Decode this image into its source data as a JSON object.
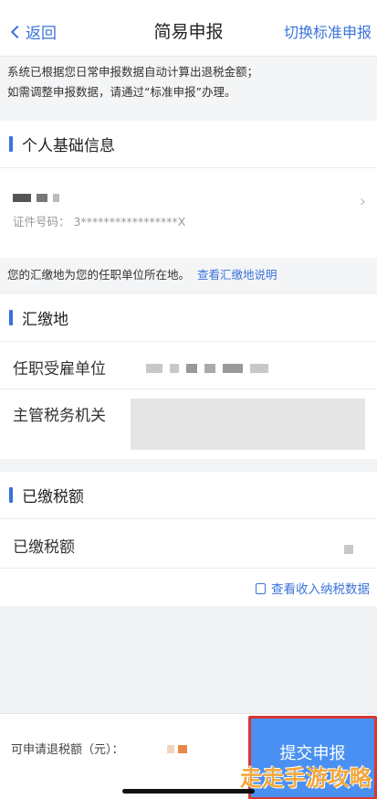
{
  "nav": {
    "back": "返回",
    "title": "简易申报",
    "switch": "切换标准申报"
  },
  "notice": {
    "line1": "系统已根据您日常申报数据自动计算出退税金额；",
    "line2": "如需调整申报数据，请通过“标准申报”办理。"
  },
  "basic_info": {
    "heading": "个人基础信息",
    "id_label": "证件号码：",
    "id_value": "3*****************X"
  },
  "tip": {
    "text": "您的汇缴地为您的任职单位所在地。",
    "link": "查看汇缴地说明"
  },
  "huijiao": {
    "heading": "汇缴地",
    "employer_label": "任职受雇单位",
    "tax_office_label": "主管税务机关"
  },
  "paid_tax": {
    "heading": "已缴税额",
    "row_label": "已缴税额",
    "view_link": "查看收入纳税数据"
  },
  "bottom": {
    "refund_label": "可申请退税额（元）：",
    "submit": "提交申报"
  },
  "watermark": "走走手游攻略",
  "colors": {
    "accent": "#3a73d9",
    "submit_bg": "#4a90f2",
    "highlight_border": "#d9362f"
  }
}
